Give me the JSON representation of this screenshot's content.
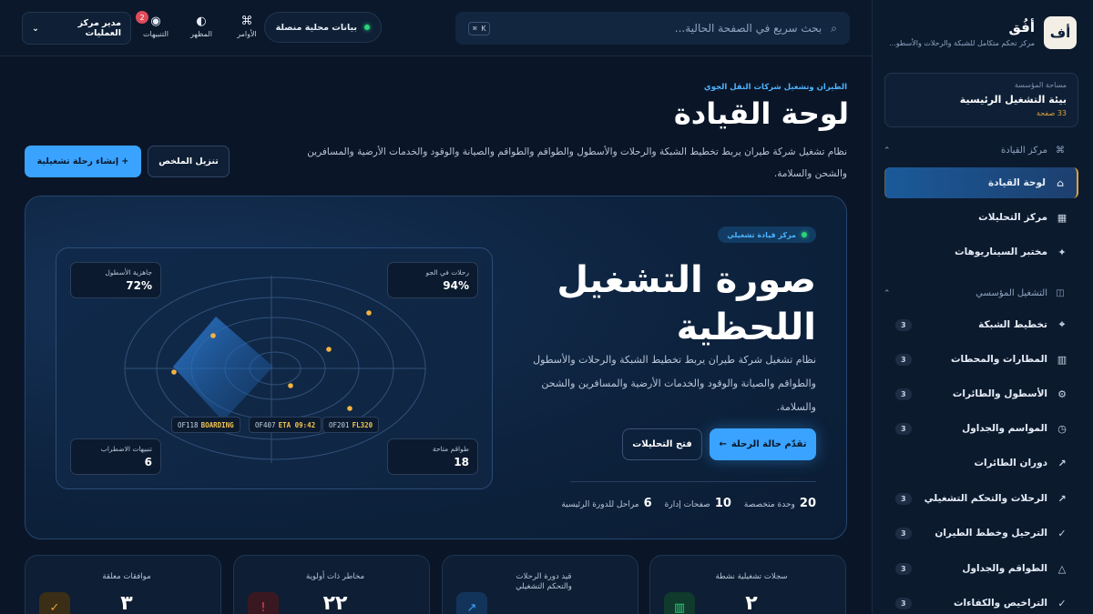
{
  "brand": {
    "logo": "أف",
    "name": "أفُق",
    "subtitle": "مركز تحكم متكامل للشبكة والرحلات والأسطو..."
  },
  "workspace": {
    "label": "مساحة المؤسسة",
    "name": "بيئة التشغيل الرئيسية",
    "count": "33 صفحة"
  },
  "nav": {
    "group1": {
      "label": "مركز القيادة",
      "icon": "command-icon"
    },
    "items1": [
      {
        "label": "لوحة القيادة",
        "icon": "home-icon",
        "active": true
      },
      {
        "label": "مركز التحليلات",
        "icon": "grid-icon"
      },
      {
        "label": "مختبر السيناريوهات",
        "icon": "sparkle-icon"
      }
    ],
    "group2": {
      "label": "التشغيل المؤسسي",
      "icon": "layout-icon"
    },
    "items2": [
      {
        "label": "تخطيط الشبكة",
        "badge": "3",
        "icon": "crosshair-icon"
      },
      {
        "label": "المطارات والمحطات",
        "badge": "3",
        "icon": "building-icon"
      },
      {
        "label": "الأسطول والطائرات",
        "badge": "3",
        "icon": "gear-icon"
      },
      {
        "label": "المواسم والجداول",
        "badge": "3",
        "icon": "clock-icon"
      },
      {
        "label": "دوران الطائرات",
        "badge": "3",
        "icon": "arrow-icon"
      },
      {
        "label": "الرحلات والتحكم التشغيلي",
        "badge": "3",
        "icon": "arrow-icon"
      },
      {
        "label": "الترحيل وخطط الطيران",
        "badge": "3",
        "icon": "check-icon"
      },
      {
        "label": "الطواقم والجداول",
        "badge": "3",
        "icon": "triangle-icon"
      },
      {
        "label": "التراخيص والكفاءات",
        "badge": "3",
        "icon": "check-icon"
      }
    ]
  },
  "topbar": {
    "search_placeholder": "بحث سريع في الصفحة الحالية...",
    "search_kbd": "⌘ K",
    "live_label": "بيانات محلية منصلة",
    "tools": [
      {
        "label": "الأوامر",
        "icon": "command-icon"
      },
      {
        "label": "المظهر",
        "icon": "contrast-icon"
      },
      {
        "label": "التنبيهات",
        "icon": "bell-icon",
        "count": "2"
      }
    ],
    "user": "مدير مركز العمليات"
  },
  "page": {
    "breadcrumb": "الطيران وتشغيل شركات النقل الجوي",
    "title": "لوحة القيادة",
    "description": "نظام تشغيل شركة طيران يربط تخطيط الشبكة والرحلات والأسطول والطواقم والطواقم والصيانة والوقود والخدمات الأرضية والمسافرين والشحن والسلامة.",
    "primary_button": "+ إنشاء رحلة تشغيلية",
    "secondary_button": "تنزيل الملخص"
  },
  "hero": {
    "tag": "مركز قيادة تشغيلي",
    "title": "صورة التشغيل اللحظية",
    "description": "نظام تشغيل شركة طيران يربط تخطيط الشبكة والرحلات والأسطول والطواقم والصيانة والوقود والخدمات الأرضية والمسافرين والشحن والسلامة.",
    "primary_button": "تقدّم حالة الرحلة",
    "secondary_button": "فتح التحليلات",
    "stats": [
      {
        "value": "20",
        "label": "وحدة متخصصة"
      },
      {
        "value": "10",
        "label": "صفحات إدارة"
      },
      {
        "value": "6",
        "label": "مراحل للدورة الرئيسية"
      }
    ]
  },
  "radar": {
    "cards": [
      {
        "label": "رحلات في الجو",
        "value": "94%"
      },
      {
        "label": "جاهزية الأسطول",
        "value": "72%"
      },
      {
        "label": "طواقم متاحة",
        "value": "18"
      },
      {
        "label": "تنبيهات الاضطراب",
        "value": "6"
      }
    ],
    "flights": [
      {
        "id": "OF201",
        "status": "FL320"
      },
      {
        "id": "OF407",
        "status": "ETA 09:42"
      },
      {
        "id": "OF118",
        "status": "BOARDING"
      }
    ]
  },
  "metrics": [
    {
      "label": "سجلات تشغيلية نشطة",
      "value": "٢",
      "icon": "chart-icon",
      "color": "#2bd47a"
    },
    {
      "label": "قيد دورة الرحلات والتحكم التشغيلي",
      "value": "",
      "icon": "arrow-up-icon",
      "color": "#3aa3ff"
    },
    {
      "label": "مخاطر ذات أولوية",
      "value": "٢٢",
      "icon": "alert-icon",
      "color": "#e04b5a"
    },
    {
      "label": "موافقات معلقة",
      "value": "٣",
      "icon": "check-icon",
      "color": "#e0a23a"
    }
  ]
}
